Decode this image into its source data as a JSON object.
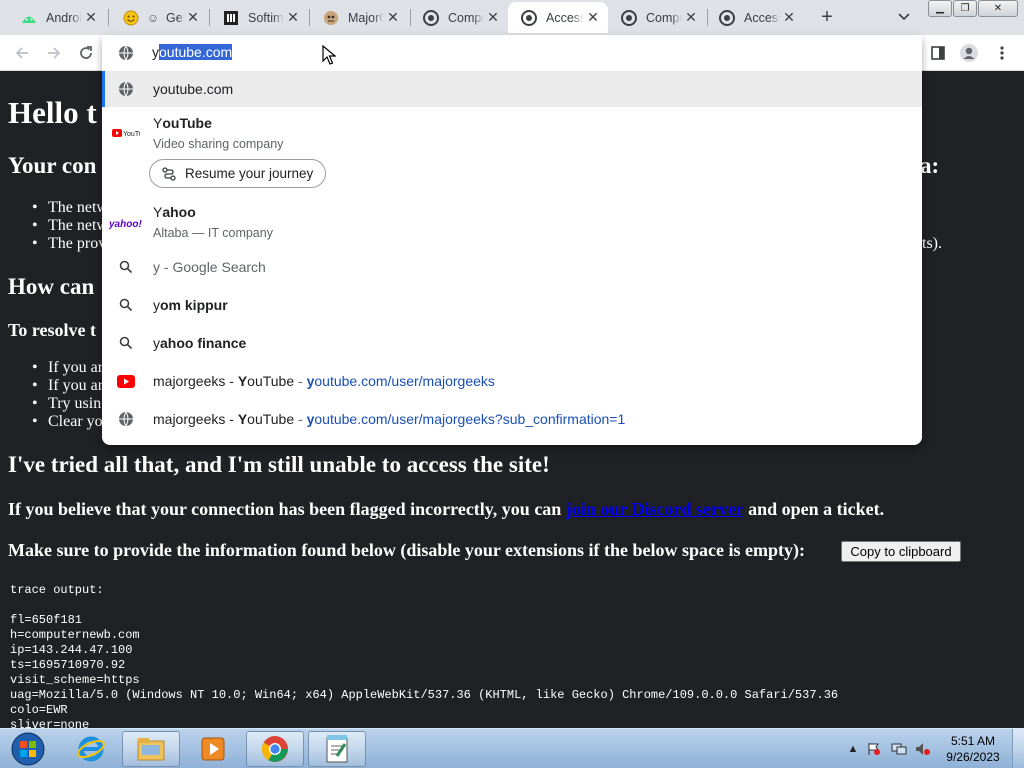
{
  "tabs": [
    {
      "title": "Android",
      "icon": "android-icon"
    },
    {
      "title": "Get",
      "icon": "smiley-icon"
    },
    {
      "title": "Softim",
      "icon": "softim-icon"
    },
    {
      "title": "MajorGeeks",
      "icon": "majorgeeks-icon"
    },
    {
      "title": "Computer",
      "icon": "cloudflare-icon"
    },
    {
      "title": "Access",
      "icon": "cloudflare-icon",
      "active": true
    },
    {
      "title": "Computer",
      "icon": "cloudflare-icon"
    },
    {
      "title": "Access",
      "icon": "cloudflare-icon"
    }
  ],
  "omnibox": {
    "typed": "y",
    "autocomplete": "outube.com",
    "suggestions": [
      {
        "kind": "url",
        "prefix": "y",
        "rest": "outube.com"
      },
      {
        "kind": "entity",
        "prefix": "Y",
        "rest": "ouTube",
        "sub": "Video sharing company",
        "chip": "Resume your journey"
      },
      {
        "kind": "entity",
        "prefix": "Y",
        "rest": "ahoo",
        "sub": "Altaba — IT company"
      },
      {
        "kind": "search",
        "text": "y - Google Search"
      },
      {
        "kind": "search",
        "prefix": "y",
        "rest": "om kippur"
      },
      {
        "kind": "search",
        "prefix": "y",
        "rest": "ahoo finance"
      },
      {
        "kind": "history",
        "name_a": "majorgeeks - ",
        "name_b": "Y",
        "name_c": "ouTube",
        "sep": " - ",
        "url_a": "y",
        "url_b": "outube.com/user/majorgeeks"
      },
      {
        "kind": "history",
        "name_a": "majorgeeks - ",
        "name_b": "Y",
        "name_c": "ouTube",
        "sep": " - ",
        "url_a": "y",
        "url_b": "outube.com/user/majorgeeks?sub_confirmation=1"
      }
    ]
  },
  "page": {
    "heading": "Hello t",
    "subheading_1_start": "Your con",
    "subheading_1_end": "a:",
    "bullets_1": [
      "The netw",
      "The netw",
      "The prov"
    ],
    "bullets_1_tail": "ts).",
    "subheading_2": "How can",
    "resolve": "To resolve t",
    "bullets_2": [
      "If you ar",
      "If you ar",
      "Try usin",
      "Clear yo"
    ],
    "subheading_3": "I've tried all that, and I'm still unable to access the site!",
    "flagged_pre": "If you believe that your connection has been flagged incorrectly, you can ",
    "flagged_link": "join our Discord server",
    "flagged_post": " and open a ticket.",
    "provide": "Make sure to provide the information found below (disable your extensions if the below space is empty):",
    "copy_button": "Copy to clipboard",
    "trace": "trace output:\n\nfl=650f181\nh=computernewb.com\nip=143.244.47.100\nts=1695710970.92\nvisit_scheme=https\nuag=Mozilla/5.0 (Windows NT 10.0; Win64; x64) AppleWebKit/537.36 (KHTML, like Gecko) Chrome/109.0.0.0 Safari/537.36\ncolo=EWR\nsliver=none"
  },
  "taskbar": {
    "time": "5:51 AM",
    "date": "9/26/2023",
    "apps": [
      "start-orb",
      "internet-explorer",
      "file-explorer",
      "media-player",
      "chrome",
      "notepad-app"
    ]
  },
  "colors": {
    "selection": "#3367d6",
    "url": "#1a4fb5",
    "page_bg": "#202124"
  }
}
